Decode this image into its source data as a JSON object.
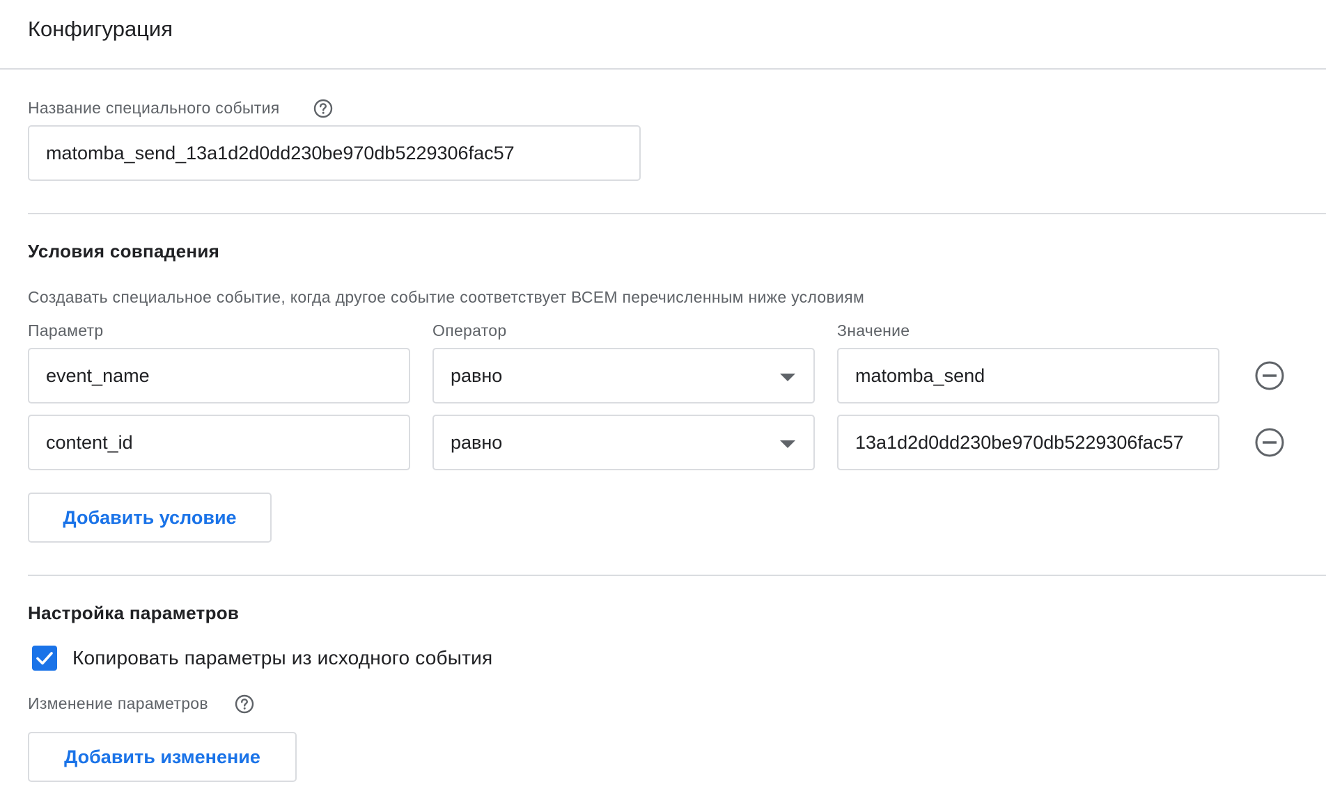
{
  "header": {
    "title": "Конфигурация"
  },
  "event_name": {
    "label": "Название специального события",
    "help_icon": "help-circle-icon",
    "value": "matomba_send_13a1d2d0dd230be970db5229306fac57"
  },
  "conditions": {
    "title": "Условия совпадения",
    "description": "Создавать специальное событие, когда другое событие соответствует ВСЕМ перечисленным ниже условиям",
    "columns": {
      "parameter": "Параметр",
      "operator": "Оператор",
      "value": "Значение"
    },
    "rows": [
      {
        "parameter": "event_name",
        "operator": "равно",
        "value": "matomba_send"
      },
      {
        "parameter": "content_id",
        "operator": "равно",
        "value": "13a1d2d0dd230be970db5229306fac57"
      }
    ],
    "remove_icon": "minus-circle-icon",
    "add_button_label": "Добавить условие"
  },
  "parameter_settings": {
    "title": "Настройка параметров",
    "copy_checkbox": {
      "label": "Копировать параметры из исходного события",
      "checked": true
    },
    "modify_label": "Изменение параметров",
    "help_icon": "help-circle-icon",
    "add_button_label": "Добавить изменение"
  },
  "colors": {
    "accent": "#1a73e8",
    "border": "#dadce0",
    "secondary_text": "#5f6368",
    "primary_text": "#202124"
  }
}
